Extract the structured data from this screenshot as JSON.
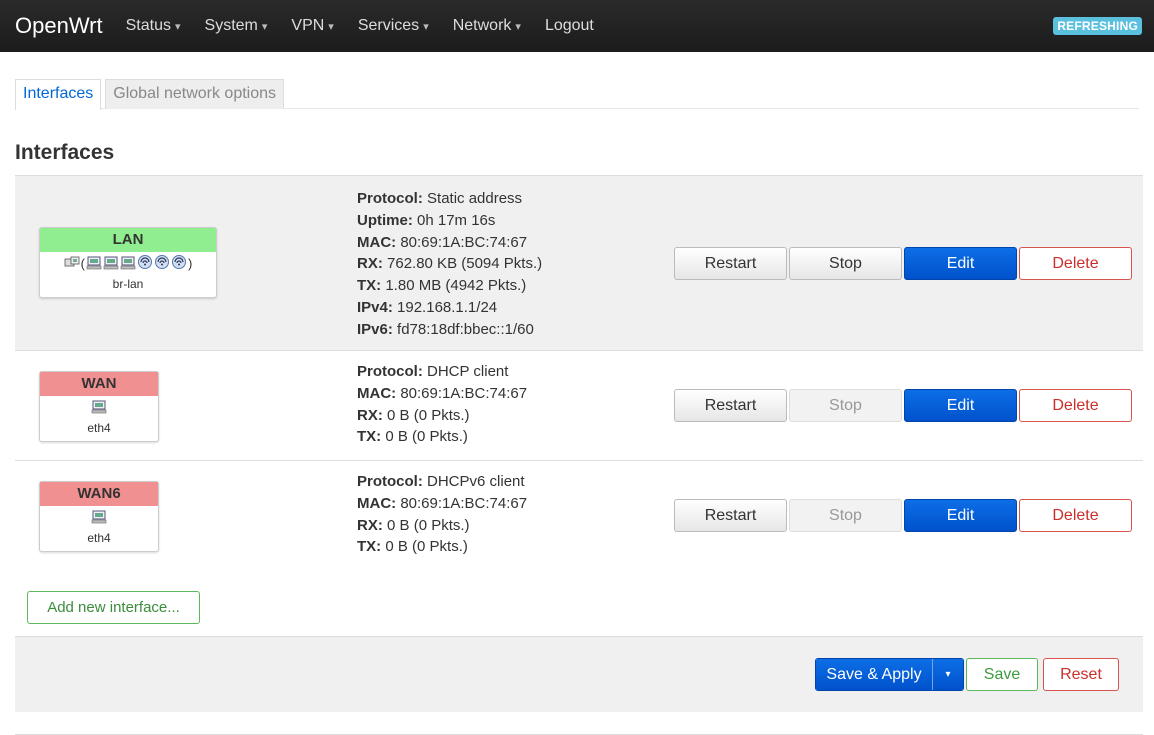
{
  "header": {
    "brand": "OpenWrt",
    "nav": [
      {
        "label": "Status",
        "dropdown": true
      },
      {
        "label": "System",
        "dropdown": true
      },
      {
        "label": "VPN",
        "dropdown": true
      },
      {
        "label": "Services",
        "dropdown": true
      },
      {
        "label": "Network",
        "dropdown": true
      },
      {
        "label": "Logout",
        "dropdown": false
      }
    ],
    "refreshing_badge": "REFRESHING"
  },
  "tabs": [
    {
      "label": "Interfaces",
      "active": true
    },
    {
      "label": "Global network options",
      "active": false
    }
  ],
  "section_title": "Interfaces",
  "interfaces": [
    {
      "name": "LAN",
      "name_color": "#90ee90",
      "device": "br-lan",
      "icons": [
        "ethernet-icon",
        "(",
        "port-icon",
        "port-icon",
        "port-icon",
        "wifi-icon",
        "wifi-icon",
        "wifi-icon",
        ")"
      ],
      "status": [
        {
          "label": "Protocol:",
          "value": "Static address"
        },
        {
          "label": "Uptime:",
          "value": "0h 17m 16s"
        },
        {
          "label": "MAC:",
          "value": "80:69:1A:BC:74:67"
        },
        {
          "label": "RX:",
          "value": "762.80 KB (5094 Pkts.)"
        },
        {
          "label": "TX:",
          "value": "1.80 MB (4942 Pkts.)"
        },
        {
          "label": "IPv4:",
          "value": "192.168.1.1/24"
        },
        {
          "label": "IPv6:",
          "value": "fd78:18df:bbec::1/60"
        }
      ],
      "stop_disabled": false
    },
    {
      "name": "WAN",
      "name_color": "#f09090",
      "device": "eth4",
      "icons": [
        "port-icon"
      ],
      "status": [
        {
          "label": "Protocol:",
          "value": "DHCP client"
        },
        {
          "label": "MAC:",
          "value": "80:69:1A:BC:74:67"
        },
        {
          "label": "RX:",
          "value": "0 B (0 Pkts.)"
        },
        {
          "label": "TX:",
          "value": "0 B (0 Pkts.)"
        }
      ],
      "stop_disabled": true
    },
    {
      "name": "WAN6",
      "name_color": "#f09090",
      "device": "eth4",
      "icons": [
        "port-icon"
      ],
      "status": [
        {
          "label": "Protocol:",
          "value": "DHCPv6 client"
        },
        {
          "label": "MAC:",
          "value": "80:69:1A:BC:74:67"
        },
        {
          "label": "RX:",
          "value": "0 B (0 Pkts.)"
        },
        {
          "label": "TX:",
          "value": "0 B (0 Pkts.)"
        }
      ],
      "stop_disabled": true
    }
  ],
  "row_buttons": {
    "restart": "Restart",
    "stop": "Stop",
    "edit": "Edit",
    "delete": "Delete"
  },
  "add_interface_label": "Add new interface...",
  "footer": {
    "save_apply": "Save & Apply",
    "dropdown_caret": "▾",
    "save": "Save",
    "reset": "Reset"
  }
}
